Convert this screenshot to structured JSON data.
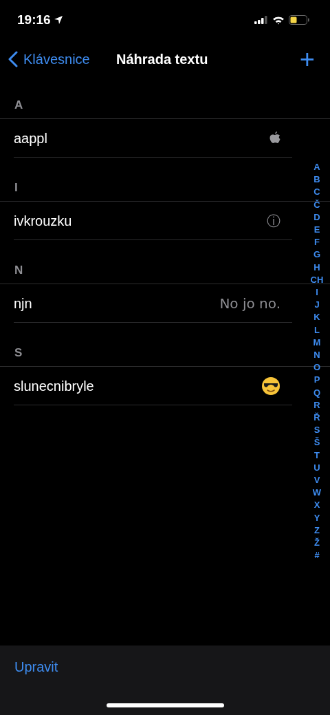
{
  "status_bar": {
    "time": "19:16"
  },
  "nav": {
    "back": "Klávesnice",
    "title": "Náhrada textu",
    "add": "+"
  },
  "sections": [
    {
      "header": "A",
      "rows": [
        {
          "shortcut": "aappl",
          "kind": "logo"
        }
      ]
    },
    {
      "header": "I",
      "rows": [
        {
          "shortcut": "ivkrouzku",
          "kind": "text",
          "phrase": "ⓘ"
        }
      ]
    },
    {
      "header": "N",
      "rows": [
        {
          "shortcut": "njn",
          "kind": "text",
          "phrase": "No jo no."
        }
      ]
    },
    {
      "header": "S",
      "rows": [
        {
          "shortcut": "slunecnibryle",
          "kind": "emoji"
        }
      ]
    }
  ],
  "index": [
    "A",
    "B",
    "C",
    "Č",
    "D",
    "E",
    "F",
    "G",
    "H",
    "CH",
    "I",
    "J",
    "K",
    "L",
    "M",
    "N",
    "O",
    "P",
    "Q",
    "R",
    "Ř",
    "S",
    "Š",
    "T",
    "U",
    "V",
    "W",
    "X",
    "Y",
    "Z",
    "Ž",
    "#"
  ],
  "toolbar": {
    "edit": "Upravit"
  }
}
